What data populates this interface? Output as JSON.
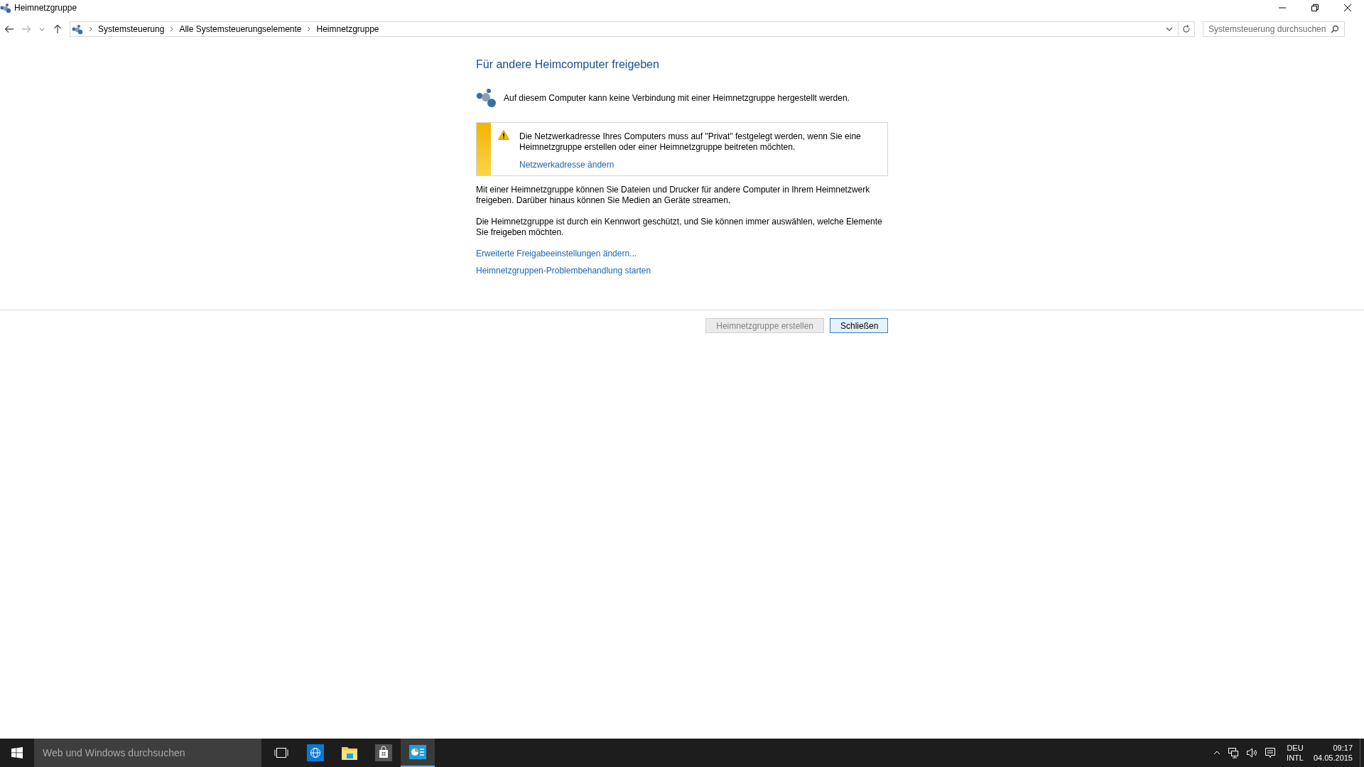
{
  "window": {
    "title": "Heimnetzgruppe"
  },
  "address_bar": {
    "breadcrumb": [
      "Systemsteuerung",
      "Alle Systemsteuerungselemente",
      "Heimnetzgruppe"
    ],
    "search": {
      "placeholder": "Systemsteuerung durchsuchen"
    }
  },
  "content": {
    "heading": "Für andere Heimcomputer freigeben",
    "status": "Auf diesem Computer kann keine Verbindung mit einer Heimnetzgruppe hergestellt werden.",
    "warning": {
      "text": "Die Netzwerkadresse Ihres Computers muss auf \"Privat\" festgelegt werden, wenn Sie eine Heimnetzgruppe erstellen oder einer Heimnetzgruppe beitreten möchten.",
      "link": "Netzwerkadresse ändern"
    },
    "paragraphs": [
      "Mit einer Heimnetzgruppe können Sie Dateien und Drucker für andere Computer in Ihrem Heimnetzwerk freigeben. Darüber hinaus können Sie Medien an Geräte streamen.",
      "Die Heimnetzgruppe ist durch ein Kennwort geschützt, und Sie können immer auswählen, welche Elemente Sie freigeben möchten."
    ],
    "links": [
      "Erweiterte Freigabeeinstellungen ändern...",
      "Heimnetzgruppen-Problembehandlung starten"
    ]
  },
  "buttons": [
    {
      "label": "Heimnetzgruppe erstellen",
      "disabled": true,
      "default": false
    },
    {
      "label": "Schließen",
      "disabled": false,
      "default": true
    }
  ],
  "taskbar": {
    "search": {
      "placeholder": "Web und Windows durchsuchen"
    },
    "apps": [
      {
        "kind": "taskview",
        "selected": false
      },
      {
        "kind": "browser",
        "selected": false
      },
      {
        "kind": "explorer",
        "selected": false
      },
      {
        "kind": "store",
        "selected": false
      },
      {
        "kind": "controlpanel",
        "selected": true
      }
    ],
    "language": [
      "DEU",
      "INTL"
    ],
    "time": "09:17",
    "date": "04.05.2015"
  }
}
